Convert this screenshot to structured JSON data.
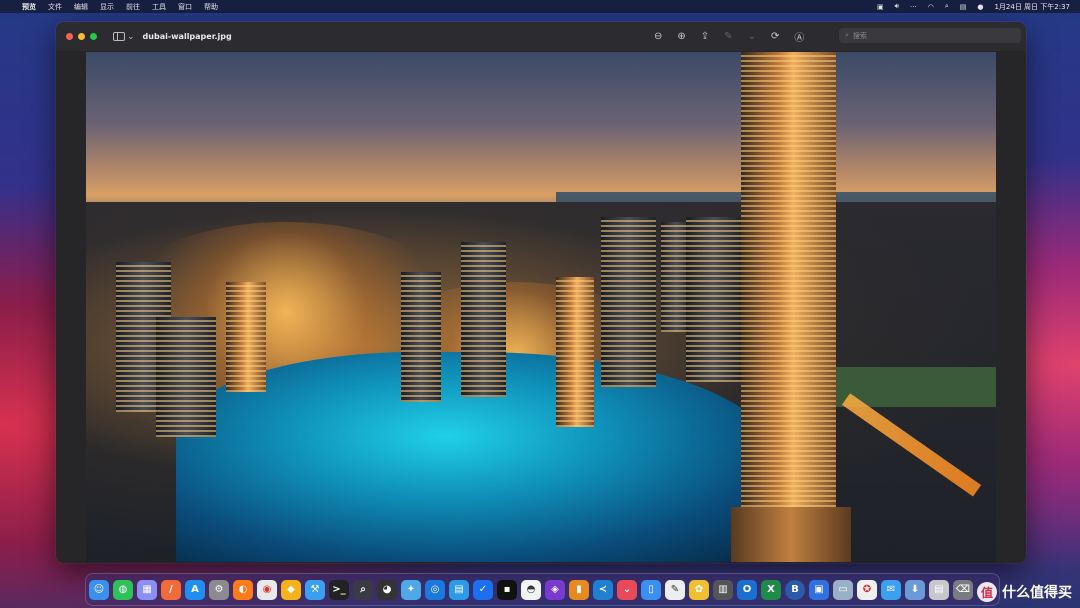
{
  "menubar": {
    "apple": "",
    "app_name": "预览",
    "items": [
      "文件",
      "编辑",
      "显示",
      "前往",
      "工具",
      "窗口",
      "帮助"
    ],
    "datetime": "1月24日 周日 下午2:37"
  },
  "window": {
    "title": "dubai-wallpaper.jpg",
    "search_placeholder": "搜索"
  },
  "watermark": {
    "glyph": "值",
    "text": "什么值得买"
  },
  "colors": {
    "close": "#ff5f57",
    "minimize": "#febc2e",
    "zoom": "#28c840"
  }
}
